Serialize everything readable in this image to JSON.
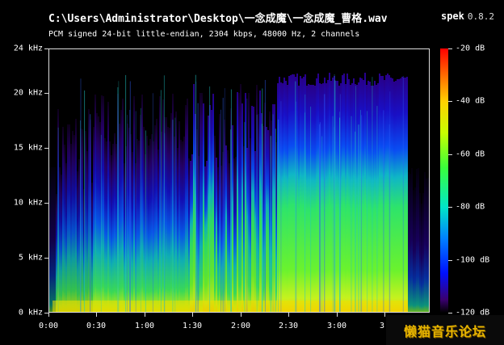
{
  "window": {
    "file_path": "C:\\Users\\Administrator\\Desktop\\一念成魔\\一念成魔_曹格.wav",
    "app_name": "spek",
    "app_version": "0.8.2",
    "file_info": "PCM signed 24-bit little-endian, 2304 kbps, 48000 Hz, 2 channels"
  },
  "watermark": {
    "text": "懒猫音乐论坛"
  },
  "chart_data": {
    "type": "heatmap",
    "title": "",
    "xlabel": "",
    "ylabel": "",
    "x_ticks": [
      "0:00",
      "0:30",
      "1:00",
      "1:30",
      "2:00",
      "2:30",
      "3:00",
      "3:"
    ],
    "x_tick_seconds": [
      0,
      30,
      60,
      90,
      120,
      150,
      180,
      210
    ],
    "x_range_seconds": [
      0,
      238
    ],
    "y_ticks": [
      "0 kHz",
      "5 kHz",
      "10 kHz",
      "15 kHz",
      "20 kHz",
      "24 kHz"
    ],
    "y_tick_values_khz": [
      0,
      5,
      10,
      15,
      20,
      24
    ],
    "y_range_khz": [
      0,
      24
    ],
    "colorbar": {
      "labels": [
        "-20 dB",
        "-40 dB",
        "-60 dB",
        "-80 dB",
        "-100 dB",
        "-120 dB"
      ],
      "values_db": [
        -20,
        -40,
        -60,
        -80,
        -100,
        -120
      ],
      "range_db": [
        -120,
        -20
      ],
      "colors": [
        "#ff0000",
        "#ff6a00",
        "#ffd000",
        "#3aff3a",
        "#00e6c8",
        "#0080ff",
        "#0010ff",
        "#3a0070",
        "#000000"
      ]
    },
    "grid": false,
    "legend": "right"
  }
}
